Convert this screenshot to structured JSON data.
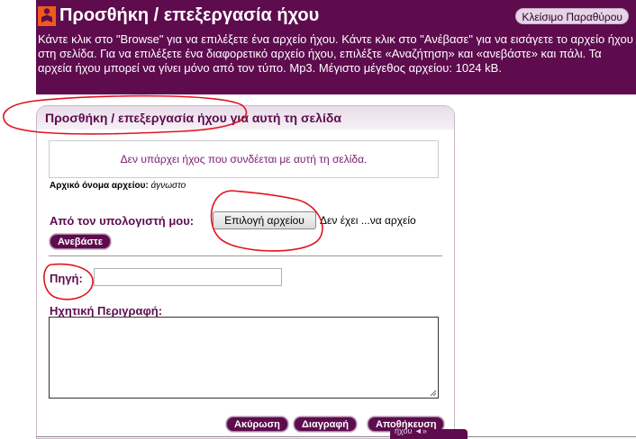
{
  "dialog": {
    "title": "Προσθήκη / επεξεργασία ήχου",
    "close_label": "Κλείσιμο Παραθύρου",
    "instructions": "Κάντε κλικ στο \"Browse\" για να επιλέξετε ένα αρχείο ήχου. Κάντε κλικ στο \"Ανέβασε\" για να εισάγετε το αρχείο ήχου στη σελίδα. Για να επιλέξετε ένα διαφορετικό αρχείο ήχου, επιλέξτε «Αναζήτηση» και «ανεβάστε» και πάλι. Τα αρχεία ήχου μπορεί να γίνει μόνο από τον τύπο. Mp3. Μέγιστο μέγεθος αρχείου: 1024 kB."
  },
  "panel": {
    "title": "Προσθήκη / επεξεργασία ήχου για αυτή τη σελίδα",
    "no_sound_message": "Δεν υπάρχει ήχος που συνδέεται με αυτή τη σελίδα.",
    "original_filename_label": "Αρχικό όνομα αρχείου:",
    "original_filename_value": "άγνωστο",
    "from_computer_label": "Από τον υπολογιστή μου:",
    "choose_file_label": "Επιλογή αρχείου",
    "no_file_text": "Δεν έχει ...να αρχείο",
    "upload_label": "Ανεβάστε",
    "source_label": "Πηγή:",
    "source_value": "",
    "description_label": "Ηχητική Περιγραφή:",
    "description_value": "",
    "cancel_label": "Ακύρωση",
    "delete_label": "Διαγραφή",
    "save_label": "Αποθήκευση"
  },
  "footer": {
    "partial_tab_text": "ήχου ◄»"
  },
  "colors": {
    "brand": "#5e0c4e",
    "annotation": "#e0141e"
  }
}
